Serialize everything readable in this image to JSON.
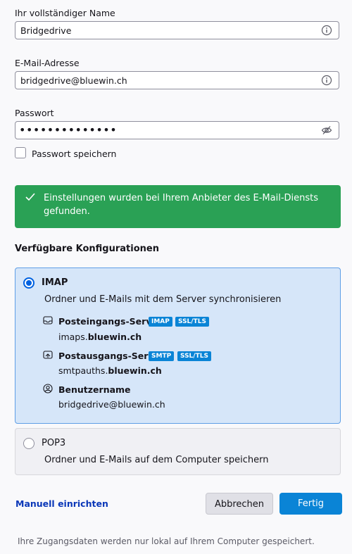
{
  "name_field": {
    "label": "Ihr vollständiger Name",
    "value": "Bridgedrive"
  },
  "email_field": {
    "label": "E-Mail-Adresse",
    "value": "bridgedrive@bluewin.ch"
  },
  "password_field": {
    "label": "Passwort",
    "value": "••••••••••••••"
  },
  "remember_password": {
    "label": "Passwort speichern",
    "checked": false
  },
  "success_message": "Einstellungen wurden bei Ihrem Anbieter des E-Mail-Diensts gefunden.",
  "configs_title": "Verfügbare Konfigurationen",
  "imap": {
    "title": "IMAP",
    "description": "Ordner und E-Mails mit dem Server synchronisieren",
    "incoming": {
      "label": "Posteingangs-Server",
      "badges": [
        "IMAP",
        "SSL/TLS"
      ],
      "host_prefix": "imaps.",
      "host_domain": "bluewin.ch"
    },
    "outgoing": {
      "label": "Postausgangs-Server",
      "badges": [
        "SMTP",
        "SSL/TLS"
      ],
      "host_prefix": "smtpauths.",
      "host_domain": "bluewin.ch"
    },
    "username": {
      "label": "Benutzername",
      "value": "bridgedrive@bluewin.ch"
    }
  },
  "pop3": {
    "title": "POP3",
    "description": "Ordner und E-Mails auf dem Computer speichern"
  },
  "actions": {
    "manual": "Manuell einrichten",
    "cancel": "Abbrechen",
    "done": "Fertig"
  },
  "footnote": "Ihre Zugangsdaten werden nur lokal auf Ihrem Computer gespeichert.",
  "colors": {
    "success": "#2aa155",
    "accent": "#0a84d6",
    "selected_bg": "#d6e6f9"
  }
}
